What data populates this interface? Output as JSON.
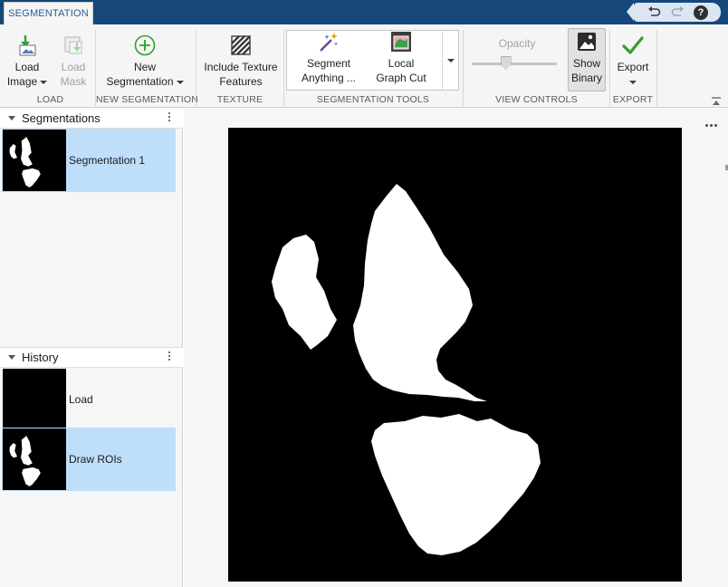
{
  "tab": {
    "label": "SEGMENTATION"
  },
  "quick_access": {
    "undo_icon": "undo-icon",
    "redo_icon": "redo-icon",
    "help_label": "?"
  },
  "toolstrip": {
    "load_image": {
      "line1": "Load",
      "line2": "Image"
    },
    "load_mask": {
      "line1": "Load",
      "line2": "Mask"
    },
    "new_segmentation": {
      "line1": "New",
      "line2": "Segmentation"
    },
    "include_texture": {
      "line1": "Include Texture",
      "line2": "Features"
    },
    "segment_anything": {
      "line1": "Segment",
      "line2": "Anything ..."
    },
    "local_graph_cut": {
      "line1": "Local",
      "line2": "Graph Cut"
    },
    "opacity": {
      "label": "Opacity",
      "level": 0.4
    },
    "show_binary": {
      "line1": "Show",
      "line2": "Binary",
      "active": true
    },
    "export": {
      "label": "Export"
    },
    "sections": {
      "load": "LOAD",
      "new_segmentation": "NEW SEGMENTATION",
      "texture": "TEXTURE",
      "segmentation_tools": "SEGMENTATION TOOLS",
      "view_controls": "VIEW CONTROLS",
      "export": "EXPORT"
    }
  },
  "segmentations": {
    "title": "Segmentations",
    "items": [
      {
        "label": "Segmentation 1",
        "selected": true
      }
    ]
  },
  "history": {
    "title": "History",
    "items": [
      {
        "label": "Load",
        "selected": false
      },
      {
        "label": "Draw ROIs",
        "selected": true
      }
    ]
  },
  "colors": {
    "title_bar": "#16477b",
    "tab_text": "#2d5c93",
    "selection": "#bfdefa",
    "toolstrip_bg": "#f5f5f5",
    "check_green": "#2fa12f",
    "mask_foreground": "#ffffff",
    "mask_background": "#000000"
  }
}
